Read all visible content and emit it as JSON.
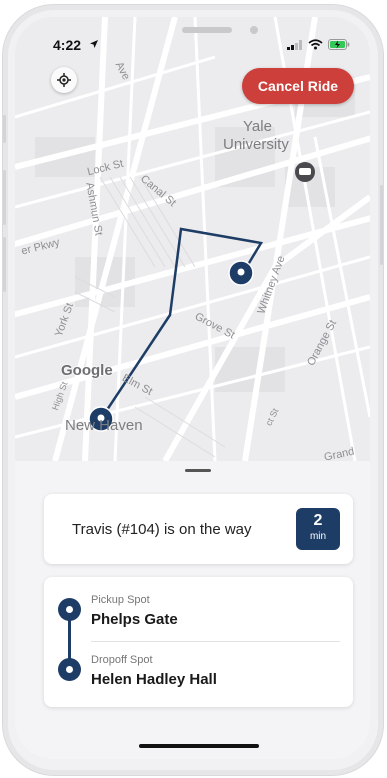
{
  "status_bar": {
    "time": "4:22"
  },
  "map": {
    "labels": {
      "yale": "Yale",
      "university": "University",
      "new_haven": "New Haven",
      "lock_st": "Lock St",
      "canal_st": "Canal St",
      "ashmun_st": "Ashmun St",
      "pkwy": "er Pkwy",
      "york_st": "York St",
      "grove_st": "Grove St",
      "whitney_ave": "Whitney Ave",
      "orange_st": "Orange St",
      "elm_st": "Elm St",
      "high_st": "High St",
      "grand_av": "Grand Av",
      "prospect": "ct St",
      "ave": "Ave"
    },
    "google_logo": "Google"
  },
  "header": {
    "cancel_label": "Cancel Ride"
  },
  "driver": {
    "status_text": "Travis (#104) is on the way",
    "eta_value": "2",
    "eta_unit": "min"
  },
  "route": {
    "pickup_caption": "Pickup Spot",
    "pickup_name": "Phelps Gate",
    "dropoff_caption": "Dropoff Spot",
    "dropoff_name": "Helen Hadley Hall"
  },
  "colors": {
    "accent_navy": "#1e3d66",
    "cancel_red": "#cc3f3a"
  }
}
